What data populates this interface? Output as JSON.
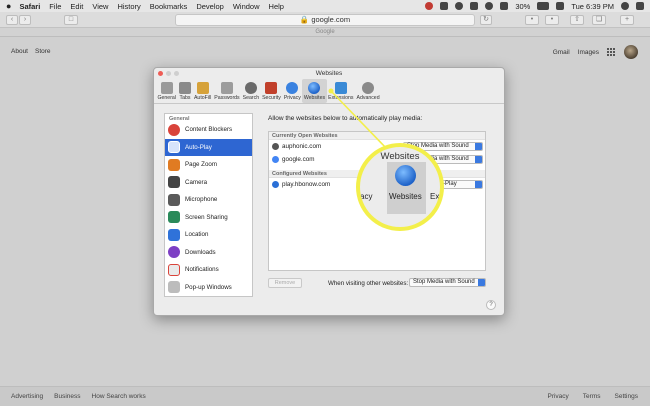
{
  "menubar": {
    "apple": "",
    "items": [
      "Safari",
      "File",
      "Edit",
      "View",
      "History",
      "Bookmarks",
      "Develop",
      "Window",
      "Help"
    ],
    "battery": "30%",
    "clock": "Tue 6:39 PM"
  },
  "toolbar": {
    "url": "google.com",
    "tab_title": "Google"
  },
  "google": {
    "top_left": [
      "About",
      "Store"
    ],
    "top_right": [
      "Gmail",
      "Images"
    ],
    "footer_left": [
      "Advertising",
      "Business",
      "How Search works"
    ],
    "footer_right": [
      "Privacy",
      "Terms",
      "Settings"
    ]
  },
  "prefs": {
    "title": "Websites",
    "tabs": [
      {
        "label": "General",
        "icon": "switch-icon",
        "color": "#9a9a9a"
      },
      {
        "label": "Tabs",
        "icon": "tabs-icon",
        "color": "#8a8a8a"
      },
      {
        "label": "AutoFill",
        "icon": "pencil-icon",
        "color": "#d6a23a"
      },
      {
        "label": "Passwords",
        "icon": "key-icon",
        "color": "#9c9c9c"
      },
      {
        "label": "Search",
        "icon": "magnifier-icon",
        "color": "#6a6a6a"
      },
      {
        "label": "Security",
        "icon": "lock-icon",
        "color": "#c1402b"
      },
      {
        "label": "Privacy",
        "icon": "hand-icon",
        "color": "#3a82e0"
      },
      {
        "label": "Websites",
        "icon": "globe-icon",
        "color": "#2a6fd6"
      },
      {
        "label": "Extensions",
        "icon": "puzzle-icon",
        "color": "#3a8ad6"
      },
      {
        "label": "Advanced",
        "icon": "gear-icon",
        "color": "#8a8a8a"
      }
    ],
    "sidebar": {
      "header": "General",
      "items": [
        {
          "label": "Content Blockers",
          "color": "#d9433a"
        },
        {
          "label": "Auto-Play",
          "color": "#2b63c9"
        },
        {
          "label": "Page Zoom",
          "color": "#e07b22"
        },
        {
          "label": "Camera",
          "color": "#444444"
        },
        {
          "label": "Microphone",
          "color": "#5a5a5a"
        },
        {
          "label": "Screen Sharing",
          "color": "#2a8a5a"
        },
        {
          "label": "Location",
          "color": "#2f72d9"
        },
        {
          "label": "Downloads",
          "color": "#7d3fc4"
        },
        {
          "label": "Notifications",
          "color": "#d9433a"
        },
        {
          "label": "Pop-up Windows",
          "color": "#bcbcbc"
        }
      ]
    },
    "content": {
      "lead": "Allow the websites below to automatically play media:",
      "open_header": "Currently Open Websites",
      "open_sites": [
        {
          "name": "auphonic.com",
          "setting": "Stop Media with Sound"
        },
        {
          "name": "google.com",
          "setting": "Stop Media with Sound"
        }
      ],
      "configured_header": "Configured Websites",
      "configured_sites": [
        {
          "name": "play.hbonow.com",
          "setting": "Allow All Auto-Play"
        }
      ],
      "remove": "Remove",
      "visit_label": "When visiting other websites:",
      "visit_value": "Stop Media with Sound",
      "help": "?"
    }
  },
  "zoom": {
    "title": "Websites",
    "left": "acy",
    "center": "Websites",
    "right": "Ext"
  },
  "colors": {
    "accent": "#2e66d2",
    "callout": "#f3ef4a"
  }
}
